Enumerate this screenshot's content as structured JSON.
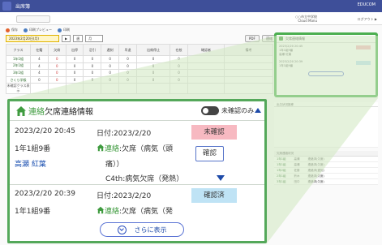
{
  "app": {
    "window_title": "出席簿",
    "brand": "EDUCOM",
    "user_line1": "○○市立中学校",
    "user_line2": "Cloud Manu",
    "logout": "ログアウト ▶",
    "toolbar": [
      "保存",
      "印刷プレビュー",
      "印刷"
    ],
    "date_label": "2023年2月20日(月)",
    "date_nav": [
      "▶",
      "週",
      "月"
    ],
    "right_buttons": [
      "PDF",
      "連絡"
    ],
    "grid": {
      "headers": [
        "クラス",
        "在籍",
        "欠席",
        "出停",
        "忌引",
        "遅刻",
        "早退",
        "出席停止",
        "在校",
        "確認者",
        "備考"
      ],
      "rows": [
        {
          "label": "1年1組",
          "cells": [
            "4",
            "0",
            "0",
            "0",
            "0",
            "0",
            "0",
            "0"
          ]
        },
        {
          "label": "2年1組",
          "cells": [
            "4",
            "0",
            "0",
            "0",
            "0",
            "0",
            "0",
            "0"
          ]
        },
        {
          "label": "3年1組",
          "cells": [
            "4",
            "0",
            "0",
            "0",
            "0",
            "0",
            "0",
            "0"
          ]
        },
        {
          "label": "さくら学級",
          "cells": [
            "0",
            "0",
            "0",
            "0",
            "0",
            "0",
            "0",
            "0"
          ]
        }
      ],
      "footer_button": "未確認クラス表示"
    },
    "side_chart_title": "出欠状況推移",
    "side_table": {
      "header": "欠席連絡状況",
      "rows": [
        {
          "cls": "1年1組",
          "name": "高瀬",
          "status": "連絡済(欠席)"
        },
        {
          "cls": "1年1組",
          "name": "高瀬",
          "status": "連絡済(欠席)"
        },
        {
          "cls": "1年2組",
          "name": "佐藤",
          "status": "連絡済(遅刻)"
        },
        {
          "cls": "2年1組",
          "name": "鈴木",
          "status": "連絡済(欠席)"
        },
        {
          "cls": "3年1組",
          "name": "田中",
          "status": "連絡済(欠席)"
        }
      ]
    }
  },
  "panel": {
    "title_green": "連絡",
    "title_rest": "欠席連絡情報",
    "toggle_label": "未確認のみ",
    "entries": [
      {
        "datetime": "2023/2/20 20:45",
        "class_no": "1年1組9番",
        "student": "高瀬 紅葉",
        "date_line": "日付:2023/2/20",
        "msg_green": "連絡",
        "msg_rest": ":欠席（病気（頭",
        "msg_cont": "痛））",
        "detail": "C4th:病気欠席（発熱）",
        "status": "未確認",
        "confirm_button": "確認"
      },
      {
        "datetime": "2023/2/20 20:39",
        "class_no": "1年1組9番",
        "date_line": "日付:2023/2/20",
        "msg_green": "連絡",
        "msg_rest": ":欠席（病気（発",
        "status": "確認済"
      }
    ],
    "more_button": "さらに表示"
  },
  "colors": {
    "accent_green": "#54a85a",
    "header_blue": "#3e4f99",
    "unconfirmed_pink": "#f7b9c1",
    "confirmed_blue": "#bfe3f5"
  }
}
